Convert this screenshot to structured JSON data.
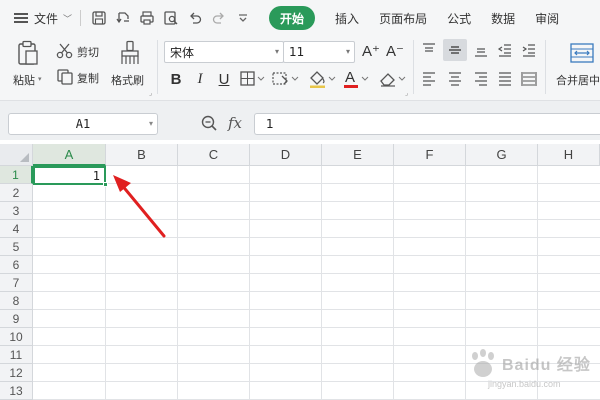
{
  "menu": {
    "file_label": "文件",
    "tabs": [
      {
        "label": "开始",
        "active": true
      },
      {
        "label": "插入",
        "active": false
      },
      {
        "label": "页面布局",
        "active": false
      },
      {
        "label": "公式",
        "active": false
      },
      {
        "label": "数据",
        "active": false
      },
      {
        "label": "审阅",
        "active": false
      }
    ]
  },
  "ribbon": {
    "paste_label": "粘贴",
    "cut_label": "剪切",
    "copy_label": "复制",
    "format_painter_label": "格式刷",
    "font_name": "宋体",
    "font_size": "11",
    "increase_font": "A⁺",
    "decrease_font": "A⁻",
    "bold": "B",
    "italic": "I",
    "underline": "U",
    "merge_center_label": "合并居中"
  },
  "formula_bar": {
    "name_box": "A1",
    "fx_label": "fx",
    "formula_value": "1"
  },
  "sheet": {
    "columns": [
      "A",
      "B",
      "C",
      "D",
      "E",
      "F",
      "G",
      "H"
    ],
    "rows": [
      "1",
      "2",
      "3",
      "4",
      "5",
      "6",
      "7",
      "8",
      "9",
      "10",
      "11",
      "12",
      "13"
    ],
    "selected_cell": "A1",
    "cell_a1_value": "1"
  },
  "watermark": {
    "text": "Baidu 经验",
    "subtext": "jingyan.baidu.com"
  },
  "colors": {
    "accent_green": "#2a9a5a",
    "annotation_red": "#e02020",
    "font_color_red": "#e02020"
  }
}
